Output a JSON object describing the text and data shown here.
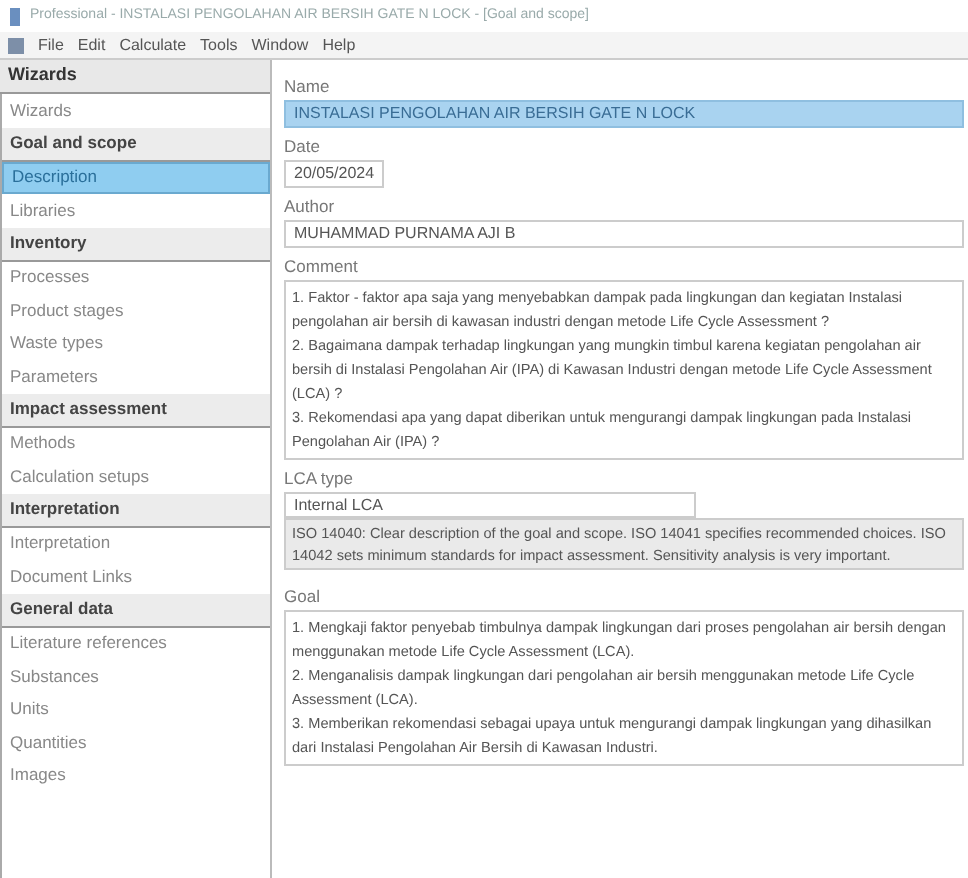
{
  "window": {
    "title": "Professional - INSTALASI PENGOLAHAN AIR BERSIH GATE N LOCK - [Goal and scope]"
  },
  "menu": [
    "File",
    "Edit",
    "Calculate",
    "Tools",
    "Window",
    "Help"
  ],
  "sidebar": {
    "title": "Wizards",
    "items": [
      {
        "kind": "item",
        "label": "Wizards",
        "selected": false
      },
      {
        "kind": "header",
        "label": "Goal and scope"
      },
      {
        "kind": "item",
        "label": "Description",
        "selected": true
      },
      {
        "kind": "item",
        "label": "Libraries",
        "selected": false
      },
      {
        "kind": "header",
        "label": "Inventory"
      },
      {
        "kind": "item",
        "label": "Processes",
        "selected": false
      },
      {
        "kind": "item",
        "label": "Product stages",
        "selected": false
      },
      {
        "kind": "item",
        "label": "Waste types",
        "selected": false
      },
      {
        "kind": "item",
        "label": "Parameters",
        "selected": false
      },
      {
        "kind": "header",
        "label": "Impact assessment"
      },
      {
        "kind": "item",
        "label": "Methods",
        "selected": false
      },
      {
        "kind": "item",
        "label": "Calculation setups",
        "selected": false
      },
      {
        "kind": "header",
        "label": "Interpretation"
      },
      {
        "kind": "item",
        "label": "Interpretation",
        "selected": false
      },
      {
        "kind": "item",
        "label": "Document Links",
        "selected": false
      },
      {
        "kind": "header",
        "label": "General data"
      },
      {
        "kind": "item",
        "label": "Literature references",
        "selected": false
      },
      {
        "kind": "item",
        "label": "Substances",
        "selected": false
      },
      {
        "kind": "item",
        "label": "Units",
        "selected": false
      },
      {
        "kind": "item",
        "label": "Quantities",
        "selected": false
      },
      {
        "kind": "item",
        "label": "Images",
        "selected": false
      }
    ]
  },
  "form": [
    {
      "kind": "field",
      "label": "Name",
      "value": "INSTALASI PENGOLAHAN AIR BERSIH GATE N LOCK",
      "highlighted": true
    },
    {
      "kind": "date",
      "label": "Date",
      "value": "20/05/2024",
      "highlighted": false
    },
    {
      "kind": "field",
      "label": "Author",
      "value": "MUHAMMAD PURNAMA AJI B",
      "highlighted": false
    },
    {
      "kind": "text",
      "label": "Comment",
      "value": "1. Faktor - faktor apa saja yang menyebabkan dampak pada lingkungan dan kegiatan Instalasi pengolahan air bersih di kawasan industri dengan metode Life Cycle Assessment ?\n2. Bagaimana dampak terhadap lingkungan yang mungkin timbul karena kegiatan pengolahan air bersih di Instalasi Pengolahan Air (IPA) di Kawasan Industri dengan metode Life Cycle Assessment (LCA) ?\n3. Rekomendasi apa yang dapat diberikan untuk mengurangi dampak lingkungan pada Instalasi Pengolahan Air (IPA) ?"
    },
    {
      "kind": "select",
      "label": "LCA type",
      "value": "Internal LCA",
      "description": "ISO 14040: Clear description of the goal and scope. ISO 14041 specifies recommended choices. ISO 14042 sets minimum standards for impact assessment. Sensitivity analysis is very important."
    },
    {
      "kind": "text",
      "label": "Goal",
      "value": "1. Mengkaji faktor penyebab timbulnya dampak lingkungan dari proses pengolahan air bersih dengan menggunakan metode Life Cycle Assessment (LCA).\n2. Menganalisis dampak lingkungan dari pengolahan air bersih menggunakan metode Life Cycle Assessment (LCA).\n3. Memberikan rekomendasi sebagai upaya untuk mengurangi dampak lingkungan yang dihasilkan dari Instalasi Pengolahan Air Bersih di Kawasan Industri."
    }
  ]
}
